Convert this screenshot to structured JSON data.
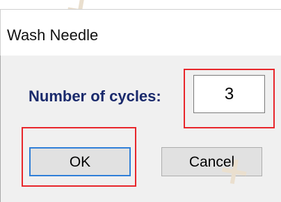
{
  "window": {
    "title": "Wash Needle"
  },
  "form": {
    "cycles_label": "Number of cycles:",
    "cycles_value": "3"
  },
  "buttons": {
    "ok_label": "OK",
    "cancel_label": "Cancel"
  },
  "colors": {
    "label_text": "#1a2a6c",
    "highlight_border": "#e8262b",
    "ok_focus_border": "#2f7fd8",
    "dialog_background": "#f0f0f0"
  }
}
